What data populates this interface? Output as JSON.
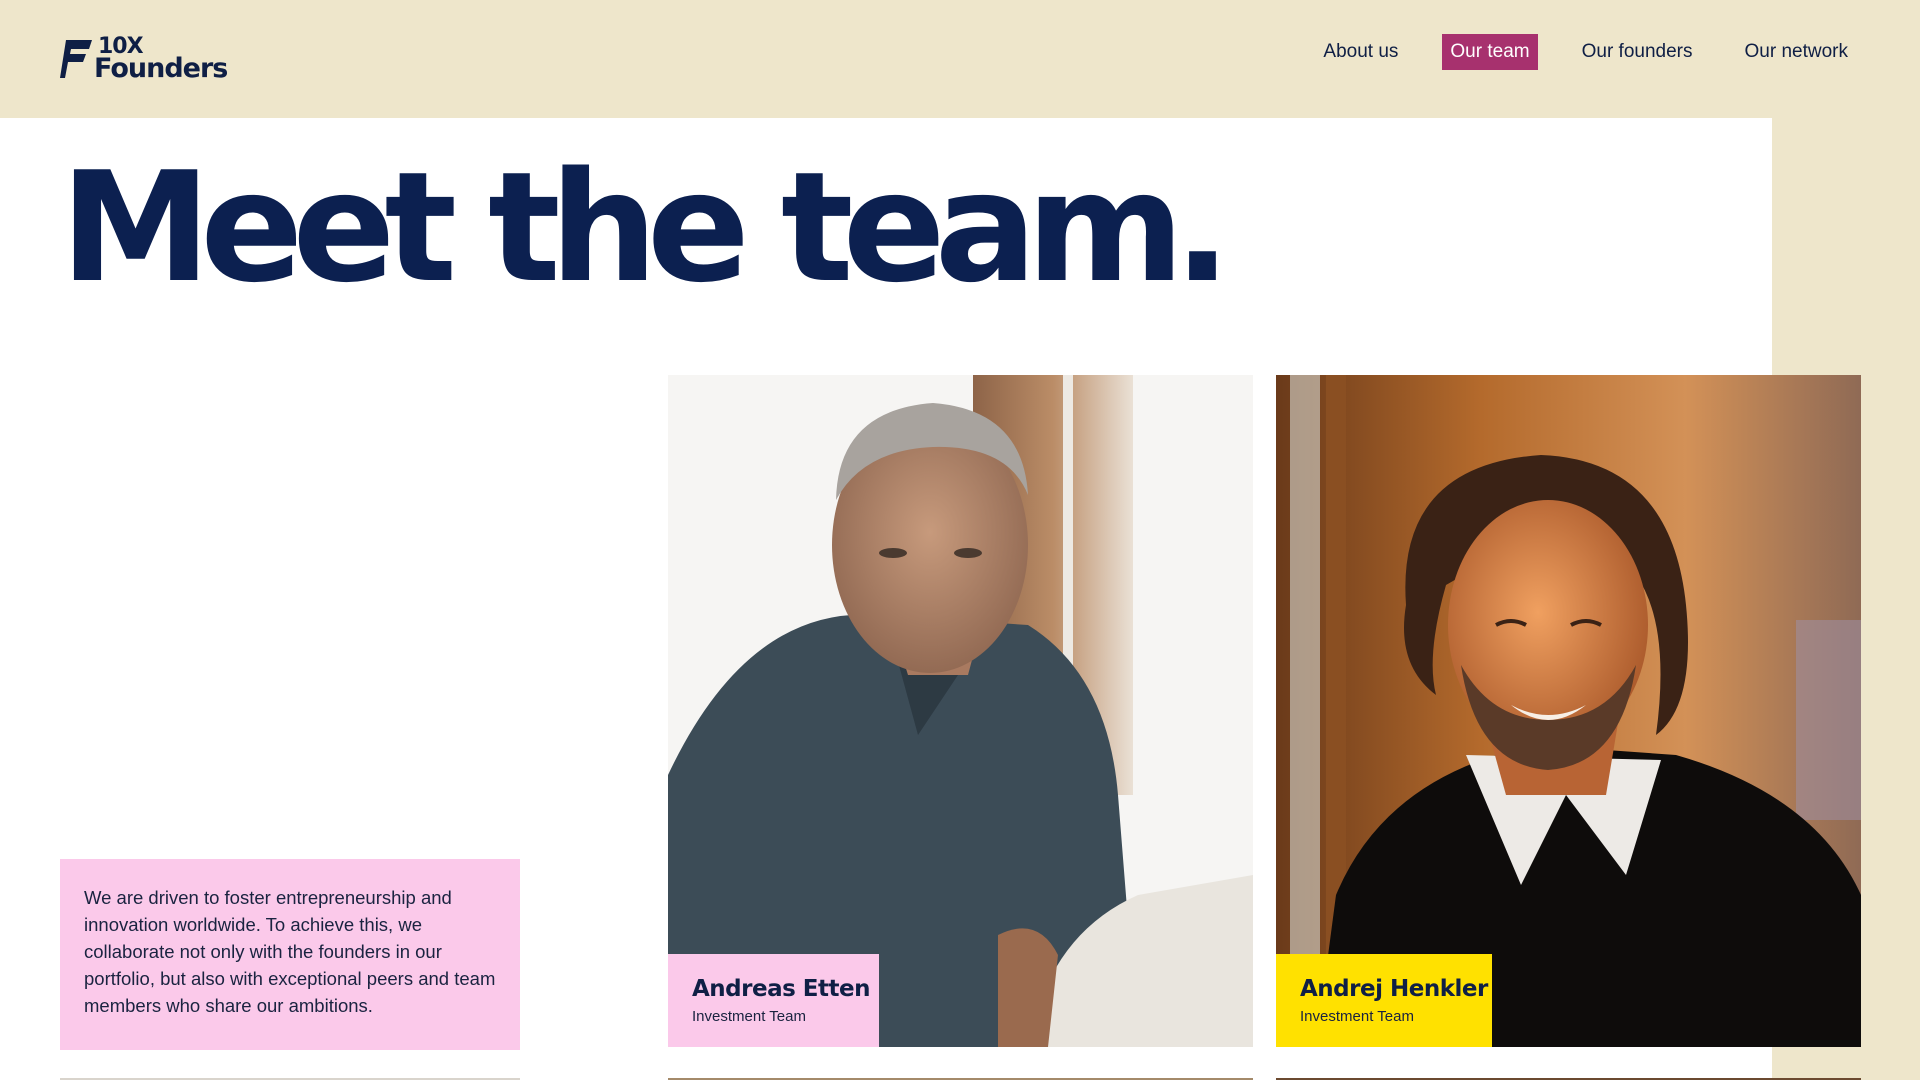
{
  "header": {
    "logo": {
      "line1": "10X",
      "line2": "Founders"
    },
    "nav": [
      {
        "label": "About us",
        "active": false
      },
      {
        "label": "Our team",
        "active": true
      },
      {
        "label": "Our founders",
        "active": false
      },
      {
        "label": "Our network",
        "active": false
      }
    ]
  },
  "hero": {
    "title": "Meet the team."
  },
  "intro": {
    "text": "We are driven to foster entrepreneurship and innovation worldwide. To achieve this, we collaborate not only with the founders in our portfolio, but also with exceptional peers and team members who share our ambitions."
  },
  "team": [
    {
      "name": "Andreas Etten",
      "role": "Investment Team",
      "tag_color": "#FBC9EA"
    },
    {
      "name": "Andrej Henkler",
      "role": "Investment Team",
      "tag_color": "#FFE100"
    }
  ],
  "colors": {
    "background": "#EEE6CB",
    "brand_navy": "#0C2050",
    "nav_active": "#A7316E",
    "intro_pink": "#FBC9EA",
    "tag_yellow": "#FFE100"
  }
}
